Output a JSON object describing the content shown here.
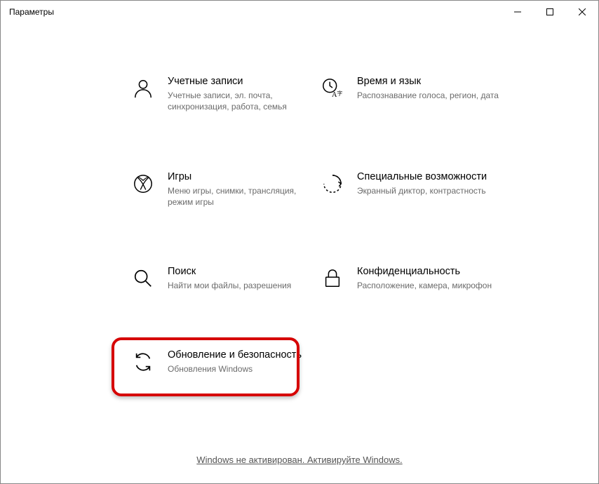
{
  "window": {
    "title": "Параметры"
  },
  "tiles": {
    "accounts": {
      "title": "Учетные записи",
      "desc": "Учетные записи, эл. почта, синхронизация, работа, семья"
    },
    "time_lang": {
      "title": "Время и язык",
      "desc": "Распознавание голоса, регион, дата"
    },
    "gaming": {
      "title": "Игры",
      "desc": "Меню игры, снимки, трансляция, режим игры"
    },
    "accessibility": {
      "title": "Специальные возможности",
      "desc": "Экранный диктор, контрастность"
    },
    "search": {
      "title": "Поиск",
      "desc": "Найти мои файлы, разрешения"
    },
    "privacy": {
      "title": "Конфиденциальность",
      "desc": "Расположение, камера, микрофон"
    },
    "update": {
      "title": "Обновление и безопасность",
      "desc": "Обновления Windows"
    }
  },
  "footer": {
    "activation_link": "Windows не активирован. Активируйте Windows."
  }
}
